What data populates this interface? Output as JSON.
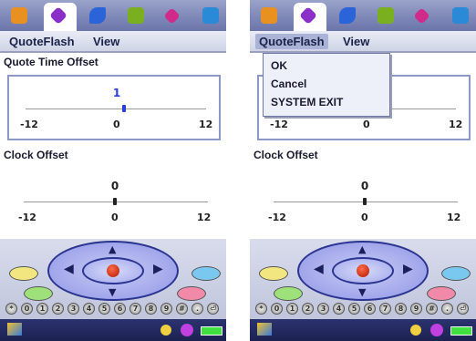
{
  "left": {
    "menubar": {
      "app_menu": "QuoteFlash",
      "view_menu": "View"
    },
    "quote_offset": {
      "title": "Quote Time Offset",
      "value": "1",
      "min": "-12",
      "zero": "0",
      "max": "12"
    },
    "clock_offset": {
      "title": "Clock Offset",
      "value": "0",
      "min": "-12",
      "zero": "0",
      "max": "12"
    }
  },
  "right": {
    "menubar": {
      "app_menu": "QuoteFlash",
      "view_menu": "View"
    },
    "dropdown": {
      "ok": "OK",
      "cancel": "Cancel",
      "exit": "SYSTEM EXIT"
    },
    "quote_offset": {
      "min": "-12",
      "zero": "0",
      "max": "12"
    },
    "clock_offset": {
      "title": "Clock Offset",
      "value": "0",
      "min": "-12",
      "zero": "0",
      "max": "12"
    }
  },
  "icons": {
    "tabs": [
      "mail-icon",
      "quote-icon",
      "phone-icon",
      "calendar-icon",
      "diamond-icon",
      "grid-icon"
    ],
    "tab_colors": [
      "#e89020",
      "#8a30c8",
      "#2a64d8",
      "#7ab020",
      "#d02a8a",
      "#2a8ad8"
    ]
  }
}
